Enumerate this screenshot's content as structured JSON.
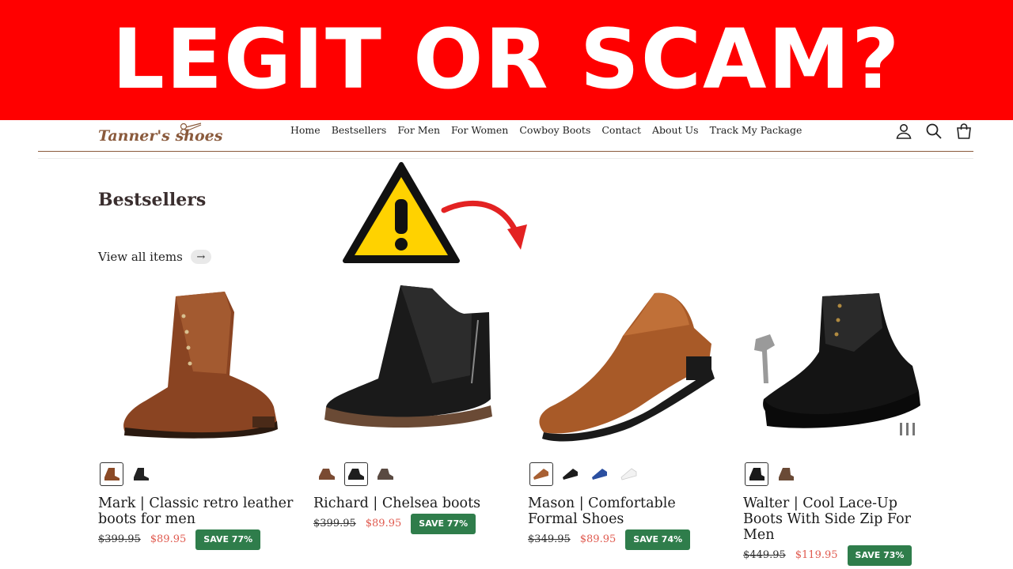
{
  "banner": {
    "text": "LEGIT OR SCAM?"
  },
  "brand": {
    "name": "Tanner's shoes",
    "color": "#8a5a3c"
  },
  "nav": {
    "items": [
      {
        "label": "Home"
      },
      {
        "label": "Bestsellers"
      },
      {
        "label": "For Men"
      },
      {
        "label": "For Women"
      },
      {
        "label": "Cowboy Boots"
      },
      {
        "label": "Contact"
      },
      {
        "label": "About Us"
      },
      {
        "label": "Track My Package"
      }
    ]
  },
  "header_icons": [
    "account-icon",
    "search-icon",
    "cart-icon"
  ],
  "section": {
    "title": "Bestsellers",
    "view_all": "View all items",
    "view_all_arrow": "→"
  },
  "colors": {
    "banner": "#ff0000",
    "sale_price": "#e05a4f",
    "badge": "#2f7d4b"
  },
  "products": [
    {
      "title": "Mark | Classic retro leather boots for men",
      "old_price": "$399.95",
      "new_price": "$89.95",
      "badge": "SAVE 77%",
      "swatches": [
        "#8b4a26",
        "#222222"
      ],
      "selected_swatch": 0
    },
    {
      "title": "Richard | Chelsea boots",
      "old_price": "$399.95",
      "new_price": "$89.95",
      "badge": "SAVE 77%",
      "swatches": [
        "#7a4a32",
        "#1e1e1e",
        "#5a4a42"
      ],
      "selected_swatch": 1
    },
    {
      "title": "Mason | Comfortable Formal Shoes",
      "old_price": "$349.95",
      "new_price": "$89.95",
      "badge": "SAVE 74%",
      "swatches": [
        "#a86033",
        "#1c1c1c",
        "#2b4fa0",
        "#f2f2f2"
      ],
      "selected_swatch": 0
    },
    {
      "title": "Walter | Cool Lace-Up Boots With Side Zip For Men",
      "old_price": "$449.95",
      "new_price": "$119.95",
      "badge": "SAVE 73%",
      "swatches": [
        "#1a1a1a",
        "#6a4a36"
      ],
      "selected_swatch": 0
    }
  ]
}
